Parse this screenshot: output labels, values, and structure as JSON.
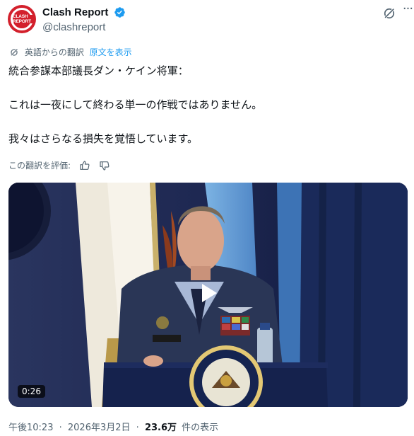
{
  "account": {
    "display_name": "Clash Report",
    "handle": "@clashreport",
    "avatar_text": "CLASH REPORT",
    "avatar_color": "#d3202c",
    "verified_icon": "verified-badge-icon",
    "verified_color": "#1d9bf0"
  },
  "translation": {
    "source_label": "英語からの翻訳",
    "show_original": "原文を表示"
  },
  "tweet": {
    "line1": "統合参謀本部議長ダン・ケイン将軍：",
    "line2": "これは一夜にして終わる単一の作戦ではありません。",
    "line3": "我々はさらなる損失を覚悟しています。"
  },
  "rating": {
    "prompt": "この翻訳を評価:",
    "thumb_up_icon": "thumbs-up-icon",
    "thumb_down_icon": "thumbs-down-icon"
  },
  "video": {
    "duration": "0:26",
    "podium_seal_text": "DEPARTMENT OF WAR",
    "podium_seal_sub": "UNITED STATES OF AMERICA"
  },
  "meta": {
    "time": "午後10:23",
    "separator1": "·",
    "date": "2026年3月2日",
    "separator2": "·",
    "views_count": "23.6万",
    "views_label": "件の表示"
  },
  "colors": {
    "text": "#0f1419",
    "secondary": "#536471",
    "link": "#1d9bf0"
  }
}
